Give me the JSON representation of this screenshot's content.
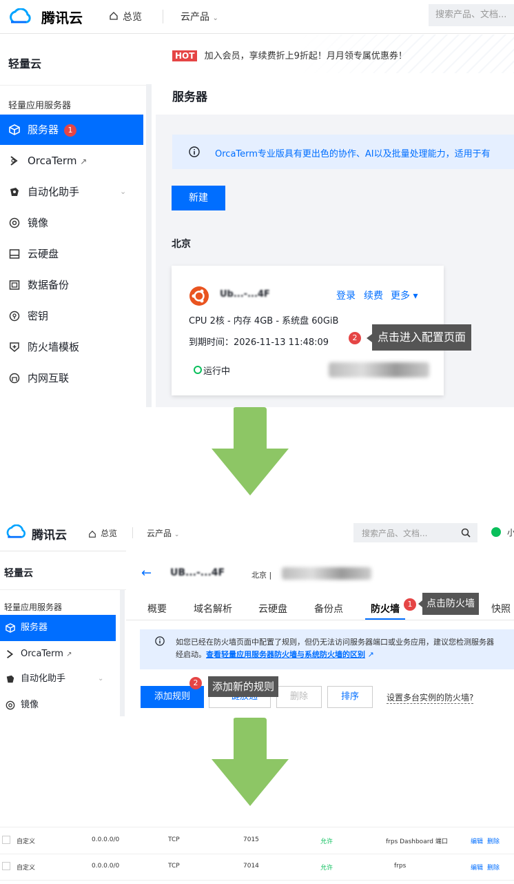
{
  "panel1": {
    "brand": "腾讯云",
    "nav_overview": "总览",
    "nav_products": "云产品",
    "search_placeholder": "搜索产品、文档...",
    "sidebar_title": "轻量云",
    "sidebar_group": "轻量应用服务器",
    "sidebar_items": [
      {
        "label": "服务器",
        "icon": "cube-icon",
        "active": true
      },
      {
        "label": "OrcaTerm",
        "icon": "terminal-icon"
      },
      {
        "label": "自动化助手",
        "icon": "robot-icon"
      },
      {
        "label": "镜像",
        "icon": "image-icon"
      },
      {
        "label": "云硬盘",
        "icon": "disk-icon"
      },
      {
        "label": "数据备份",
        "icon": "backup-icon"
      },
      {
        "label": "密钥",
        "icon": "key-icon"
      },
      {
        "label": "防火墙模板",
        "icon": "shield-icon"
      },
      {
        "label": "内网互联",
        "icon": "network-icon"
      }
    ],
    "badge_1": "1",
    "hot_tag": "HOT",
    "promo_text": "加入会员，享续费折上9折起！月月领专属优惠券！",
    "page_title": "服务器",
    "info_text": "OrcaTerm专业版具有更出色的协作、AI以及批量处理能力，适用于有",
    "new_button": "新建",
    "region": "北京",
    "card": {
      "name": "Ub...-...4F",
      "login": "登录",
      "renew": "续费",
      "more": "更多 ▾",
      "specs": "CPU 2核 - 内存 4GB - 系统盘 60GiB",
      "expire": "到期时间：2026-11-13 11:48:09",
      "status": "运行中"
    },
    "badge_2": "2",
    "tooltip": "点击进入配置页面"
  },
  "panel2": {
    "brand": "腾讯云",
    "nav_overview": "总览",
    "nav_products": "云产品",
    "search_placeholder": "搜索产品、文档...",
    "user_initial": "小",
    "sidebar_title": "轻量云",
    "sidebar_group": "轻量应用服务器",
    "sidebar_items": [
      {
        "label": "服务器",
        "active": true
      },
      {
        "label": "OrcaTerm"
      },
      {
        "label": "自动化助手"
      },
      {
        "label": "镜像"
      }
    ],
    "instance_name": "UB...-...4F",
    "instance_region": "北京 |",
    "tabs": [
      "概要",
      "域名解析",
      "云硬盘",
      "备份点",
      "防火墙",
      "快照"
    ],
    "tab_badge": "1",
    "tab_tooltip": "点击防火墙",
    "notice_line1": "如您已经在防火墙页面中配置了规则，但仍无法访问服务器端口或业务应用，建议您检测服务器",
    "notice_line2_prefix": "经启动。",
    "notice_link": "查看轻量应用服务器防火墙与系统防火墙的区别",
    "add_rule": "添加规则",
    "one_click": "一键放通",
    "delete": "删除",
    "sort": "排序",
    "multi_fw": "设置多台实例的防火墙?",
    "rule_badge": "2",
    "rule_tooltip": "添加新的规则"
  },
  "panel3": {
    "rows": [
      {
        "type": "自定义",
        "source": "0.0.0.0/0",
        "protocol": "TCP",
        "port": "7015",
        "policy": "允许",
        "remark": "frps Dashboard 端口",
        "edit": "编辑",
        "del": "删除"
      },
      {
        "type": "自定义",
        "source": "0.0.0.0/0",
        "protocol": "TCP",
        "port": "7014",
        "policy": "允许",
        "remark": "frps",
        "edit": "编辑",
        "del": "删除"
      }
    ]
  },
  "colors": {
    "accent": "#006eff",
    "badge": "#e54545",
    "arrow": "#8dc665",
    "success": "#0abf5b"
  }
}
